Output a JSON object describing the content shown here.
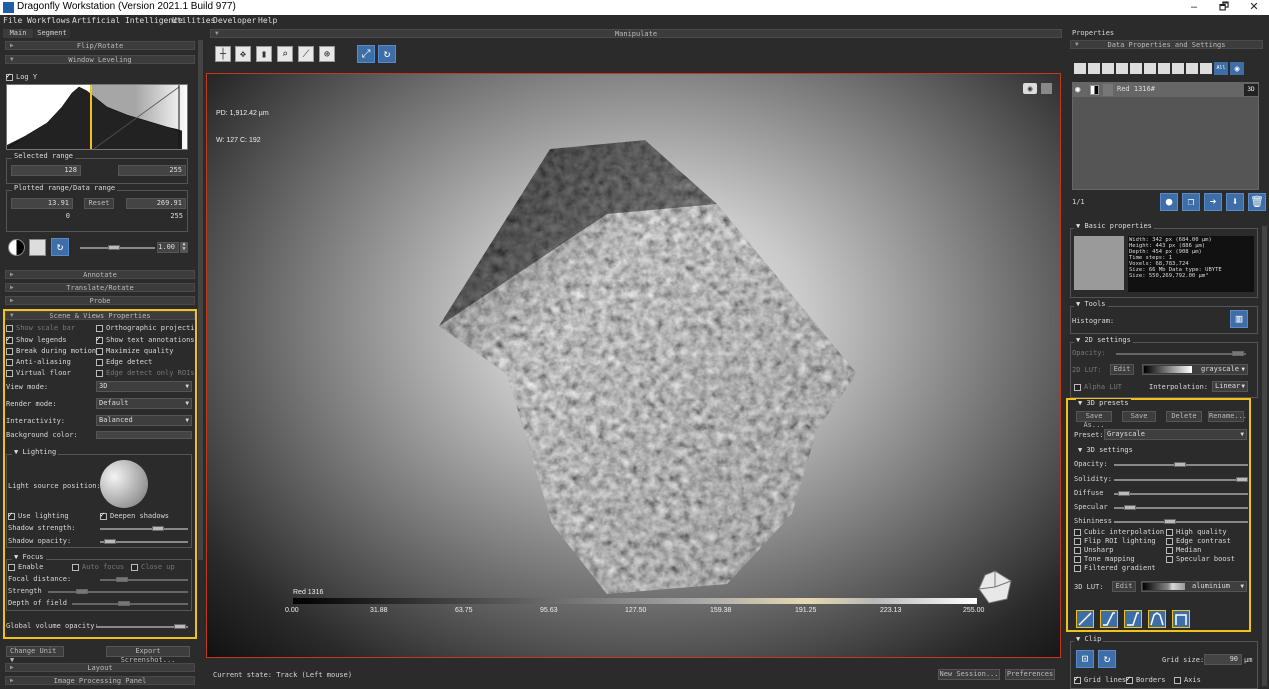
{
  "app": {
    "title": "Dragonfly Workstation (Version 2021.1 Build 977)",
    "win_min": "–",
    "win_max": "🗗",
    "win_close": "✕"
  },
  "menu": [
    "File",
    "Workflows",
    "Artificial Intelligence",
    "Utilities",
    "Developer",
    "Help"
  ],
  "left": {
    "tabs": [
      "Main",
      "Segment"
    ],
    "sections": {
      "flip_rotate": "Flip/Rotate",
      "window_leveling": "Window Leveling",
      "annotate": "Annotate",
      "translate_rotate": "Translate/Rotate",
      "probe": "Probe",
      "scene_views": "Scene & Views Properties",
      "layout": "Layout",
      "image_processing": "Image Processing Panel"
    },
    "log_y": "Log Y",
    "selected_range": {
      "title": "Selected range",
      "min": "128",
      "max": "255"
    },
    "plotted_range": {
      "title": "Plotted range/Data range",
      "min": "13.91",
      "reset": "Reset",
      "max": "269.91",
      "data_min": "0",
      "data_max": "255"
    },
    "contrast_value": "1.00",
    "scene": {
      "checks": [
        {
          "label": "Show scale bar",
          "checked": false,
          "disabled": true
        },
        {
          "label": "Orthographic projecti",
          "checked": false
        },
        {
          "label": "Show legends",
          "checked": true
        },
        {
          "label": "Show text annotations",
          "checked": true
        },
        {
          "label": "Break during motion",
          "checked": false
        },
        {
          "label": "Maximize quality",
          "checked": false
        },
        {
          "label": "Anti-aliasing",
          "checked": false
        },
        {
          "label": "Edge detect",
          "checked": false
        },
        {
          "label": "Virtual floor",
          "checked": false
        },
        {
          "label": "Edge detect only ROIs",
          "checked": false,
          "disabled": true
        }
      ],
      "view_mode_label": "View mode:",
      "view_mode": "3D",
      "render_mode_label": "Render mode:",
      "render_mode": "Default",
      "interactivity_label": "Interactivity:",
      "interactivity": "Balanced",
      "bg_color_label": "Background color:",
      "lighting": {
        "title": "Lighting",
        "light_pos": "Light source position:",
        "use_lighting": "Use lighting",
        "deepen_shadows": "Deepen shadows",
        "shadow_strength": "Shadow strength:",
        "shadow_opacity": "Shadow opacity:"
      },
      "focus": {
        "title": "Focus",
        "enable": "Enable",
        "auto_focus": "Auto focus",
        "close_up": "Close up",
        "focal_distance": "Focal distance:",
        "strength": "Strength",
        "depth_of_field": "Depth of field"
      },
      "global_opacity": "Global volume opacity:"
    },
    "change_unit": "Change Unit",
    "export_screenshot": "Export Screenshot..."
  },
  "center": {
    "manipulate": "Manipulate",
    "pd": "PD: 1,912.42 µm",
    "wc": "W: 127 C: 192",
    "colorbar_title": "Red 1316",
    "ticks": [
      "0.00",
      "31.88",
      "63.75",
      "95.63",
      "127.50",
      "159.38",
      "191.25",
      "223.13",
      "255.00"
    ],
    "status": "Current state: Track (Left mouse)",
    "new_session": "New Session...",
    "preferences": "Preferences"
  },
  "right": {
    "properties": "Properties",
    "data_props": "Data Properties and Settings",
    "dataset_name": "Red 1316#",
    "dataset_badge": "3D",
    "filter_all": "All",
    "page": "1/1",
    "basic": {
      "title": "Basic properties",
      "lines": [
        "Width: 342 px (684.00 µm)",
        "Height: 443 px (886 µm)",
        "Depth: 454 px (908 µm)",
        "Time steps: 1",
        "Voxels: 68,783,724",
        "Size: 66 Mb  Data type: UBYTE",
        "Size: 550,269,792.00 µm³"
      ]
    },
    "tools": {
      "title": "Tools",
      "histogram": "Histogram:"
    },
    "s2d": {
      "title": "2D settings",
      "opacity": "Opacity:",
      "lut": "2D LUT:",
      "edit": "Edit",
      "lut_value": "grayscale",
      "alpha_lut": "Alpha LUT",
      "interpolation": "Interpolation:",
      "interp_value": "Linear"
    },
    "presets": {
      "title": "3D presets",
      "save_as": "Save As...",
      "save": "Save",
      "delete": "Delete",
      "rename": "Rename...",
      "preset_label": "Preset:",
      "preset_value": "Grayscale"
    },
    "s3d": {
      "title": "3D settings",
      "sliders": [
        {
          "label": "Opacity:",
          "value": 0.48
        },
        {
          "label": "Solidity:",
          "value": 0.97
        },
        {
          "label": "Diffuse",
          "value": 0.03
        },
        {
          "label": "Specular",
          "value": 0.07
        },
        {
          "label": "Shininess",
          "value": 0.28
        }
      ],
      "checks": [
        {
          "label": "Cubic interpolation",
          "checked": false
        },
        {
          "label": "High quality",
          "checked": false
        },
        {
          "label": "Flip ROI lighting",
          "checked": false
        },
        {
          "label": "Edge contrast",
          "checked": false
        },
        {
          "label": "Unsharp",
          "checked": false
        },
        {
          "label": "Median",
          "checked": false
        },
        {
          "label": "Tone mapping",
          "checked": false
        },
        {
          "label": "Specular boost",
          "checked": false
        },
        {
          "label": "Filtered gradient",
          "checked": false
        }
      ],
      "lut": "3D LUT:",
      "edit": "Edit",
      "lut_value": "aluminium"
    },
    "clip": {
      "title": "Clip",
      "grid_size": "Grid size:",
      "grid_value": "90",
      "unit": "µm",
      "grid_lines": "Grid lines",
      "borders": "Borders",
      "axis": "Axis"
    }
  },
  "colors": {
    "accent": "#f2c21b",
    "blue": "#3d6ea8",
    "viewport_border": "#c03a20"
  }
}
